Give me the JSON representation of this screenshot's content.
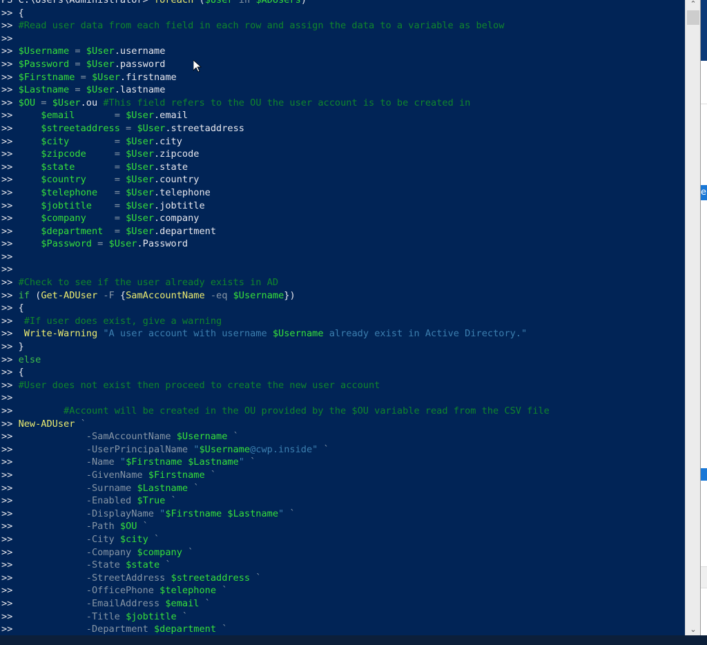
{
  "colors": {
    "background": "#012456",
    "variable": "#36e03a",
    "comment": "#10862c",
    "command": "#ecec70",
    "parameter": "#8796a6",
    "string": "#3c7fb0"
  },
  "lines": [
    [
      [
        "PS C:\\Users\\Administrator> ",
        "p"
      ],
      [
        "foreach",
        "cmd"
      ],
      [
        " (",
        "p"
      ],
      [
        "$User",
        "v"
      ],
      [
        " in ",
        "op"
      ],
      [
        "$ADUsers",
        "v"
      ],
      [
        ")",
        "p"
      ]
    ],
    [
      [
        ">> {",
        "p"
      ]
    ],
    [
      [
        ">> ",
        "p"
      ],
      [
        "#Read user data from each field in each row and assign the data to a variable as below",
        "c"
      ]
    ],
    [
      [
        ">>",
        "p"
      ]
    ],
    [
      [
        ">> ",
        "p"
      ],
      [
        "$Username",
        "v"
      ],
      [
        " = ",
        "op"
      ],
      [
        "$User",
        "v"
      ],
      [
        ".username",
        "p"
      ]
    ],
    [
      [
        ">> ",
        "p"
      ],
      [
        "$Password",
        "v"
      ],
      [
        " = ",
        "op"
      ],
      [
        "$User",
        "v"
      ],
      [
        ".password",
        "p"
      ]
    ],
    [
      [
        ">> ",
        "p"
      ],
      [
        "$Firstname",
        "v"
      ],
      [
        " = ",
        "op"
      ],
      [
        "$User",
        "v"
      ],
      [
        ".firstname",
        "p"
      ]
    ],
    [
      [
        ">> ",
        "p"
      ],
      [
        "$Lastname",
        "v"
      ],
      [
        " = ",
        "op"
      ],
      [
        "$User",
        "v"
      ],
      [
        ".lastname",
        "p"
      ]
    ],
    [
      [
        ">> ",
        "p"
      ],
      [
        "$OU",
        "v"
      ],
      [
        " = ",
        "op"
      ],
      [
        "$User",
        "v"
      ],
      [
        ".ou ",
        "p"
      ],
      [
        "#This field refers to the OU the user account is to be created in",
        "c"
      ]
    ],
    [
      [
        ">>     ",
        "p"
      ],
      [
        "$email",
        "v"
      ],
      [
        "       = ",
        "op"
      ],
      [
        "$User",
        "v"
      ],
      [
        ".email",
        "p"
      ]
    ],
    [
      [
        ">>     ",
        "p"
      ],
      [
        "$streetaddress",
        "v"
      ],
      [
        " = ",
        "op"
      ],
      [
        "$User",
        "v"
      ],
      [
        ".streetaddress",
        "p"
      ]
    ],
    [
      [
        ">>     ",
        "p"
      ],
      [
        "$city",
        "v"
      ],
      [
        "        = ",
        "op"
      ],
      [
        "$User",
        "v"
      ],
      [
        ".city",
        "p"
      ]
    ],
    [
      [
        ">>     ",
        "p"
      ],
      [
        "$zipcode",
        "v"
      ],
      [
        "     = ",
        "op"
      ],
      [
        "$User",
        "v"
      ],
      [
        ".zipcode",
        "p"
      ]
    ],
    [
      [
        ">>     ",
        "p"
      ],
      [
        "$state",
        "v"
      ],
      [
        "       = ",
        "op"
      ],
      [
        "$User",
        "v"
      ],
      [
        ".state",
        "p"
      ]
    ],
    [
      [
        ">>     ",
        "p"
      ],
      [
        "$country",
        "v"
      ],
      [
        "     = ",
        "op"
      ],
      [
        "$User",
        "v"
      ],
      [
        ".country",
        "p"
      ]
    ],
    [
      [
        ">>     ",
        "p"
      ],
      [
        "$telephone",
        "v"
      ],
      [
        "   = ",
        "op"
      ],
      [
        "$User",
        "v"
      ],
      [
        ".telephone",
        "p"
      ]
    ],
    [
      [
        ">>     ",
        "p"
      ],
      [
        "$jobtitle",
        "v"
      ],
      [
        "    = ",
        "op"
      ],
      [
        "$User",
        "v"
      ],
      [
        ".jobtitle",
        "p"
      ]
    ],
    [
      [
        ">>     ",
        "p"
      ],
      [
        "$company",
        "v"
      ],
      [
        "     = ",
        "op"
      ],
      [
        "$User",
        "v"
      ],
      [
        ".company",
        "p"
      ]
    ],
    [
      [
        ">>     ",
        "p"
      ],
      [
        "$department",
        "v"
      ],
      [
        "  = ",
        "op"
      ],
      [
        "$User",
        "v"
      ],
      [
        ".department",
        "p"
      ]
    ],
    [
      [
        ">>     ",
        "p"
      ],
      [
        "$Password",
        "v"
      ],
      [
        " = ",
        "op"
      ],
      [
        "$User",
        "v"
      ],
      [
        ".Password",
        "p"
      ]
    ],
    [
      [
        ">>",
        "p"
      ]
    ],
    [
      [
        ">>",
        "p"
      ]
    ],
    [
      [
        ">> ",
        "p"
      ],
      [
        "#Check to see if the user already exists in AD",
        "c"
      ]
    ],
    [
      [
        ">> ",
        "p"
      ],
      [
        "if",
        "kw"
      ],
      [
        " (",
        "p"
      ],
      [
        "Get-ADUser",
        "cmd"
      ],
      [
        " -F ",
        "op"
      ],
      [
        "{",
        "p"
      ],
      [
        "SamAccountName",
        "cmd"
      ],
      [
        " -eq ",
        "op"
      ],
      [
        "$Username",
        "v"
      ],
      [
        "})",
        "p"
      ]
    ],
    [
      [
        ">> {",
        "p"
      ]
    ],
    [
      [
        ">>  ",
        "p"
      ],
      [
        "#If user does exist, give a warning",
        "c"
      ]
    ],
    [
      [
        ">>  ",
        "p"
      ],
      [
        "Write-Warning",
        "cmd"
      ],
      [
        " \"A user account with username ",
        "s"
      ],
      [
        "$Username",
        "v"
      ],
      [
        " already exist in Active Directory.\"",
        "s"
      ]
    ],
    [
      [
        ">> }",
        "p"
      ]
    ],
    [
      [
        ">> ",
        "p"
      ],
      [
        "else",
        "kw"
      ]
    ],
    [
      [
        ">> {",
        "p"
      ]
    ],
    [
      [
        ">> ",
        "p"
      ],
      [
        "#User does not exist then proceed to create the new user account",
        "c"
      ]
    ],
    [
      [
        ">>",
        "p"
      ]
    ],
    [
      [
        ">>         ",
        "p"
      ],
      [
        "#Account will be created in the OU provided by the $OU variable read from the CSV file",
        "c"
      ]
    ],
    [
      [
        ">> ",
        "p"
      ],
      [
        "New-ADUser",
        "cmd"
      ],
      [
        " `",
        "op"
      ]
    ],
    [
      [
        ">>             ",
        "p"
      ],
      [
        "-SamAccountName ",
        "op"
      ],
      [
        "$Username",
        "v"
      ],
      [
        " `",
        "op"
      ]
    ],
    [
      [
        ">>             ",
        "p"
      ],
      [
        "-UserPrincipalName ",
        "op"
      ],
      [
        "\"",
        "s"
      ],
      [
        "$Username",
        "v"
      ],
      [
        "@cwp.inside\"",
        "s"
      ],
      [
        " `",
        "op"
      ]
    ],
    [
      [
        ">>             ",
        "p"
      ],
      [
        "-Name ",
        "op"
      ],
      [
        "\"",
        "s"
      ],
      [
        "$Firstname $Lastname",
        "v"
      ],
      [
        "\"",
        "s"
      ],
      [
        " `",
        "op"
      ]
    ],
    [
      [
        ">>             ",
        "p"
      ],
      [
        "-GivenName ",
        "op"
      ],
      [
        "$Firstname",
        "v"
      ],
      [
        " `",
        "op"
      ]
    ],
    [
      [
        ">>             ",
        "p"
      ],
      [
        "-Surname ",
        "op"
      ],
      [
        "$Lastname",
        "v"
      ],
      [
        " `",
        "op"
      ]
    ],
    [
      [
        ">>             ",
        "p"
      ],
      [
        "-Enabled ",
        "op"
      ],
      [
        "$True",
        "v"
      ],
      [
        " `",
        "op"
      ]
    ],
    [
      [
        ">>             ",
        "p"
      ],
      [
        "-DisplayName ",
        "op"
      ],
      [
        "\"",
        "s"
      ],
      [
        "$Firstname $Lastname",
        "v"
      ],
      [
        "\"",
        "s"
      ],
      [
        " `",
        "op"
      ]
    ],
    [
      [
        ">>             ",
        "p"
      ],
      [
        "-Path ",
        "op"
      ],
      [
        "$OU",
        "v"
      ],
      [
        " `",
        "op"
      ]
    ],
    [
      [
        ">>             ",
        "p"
      ],
      [
        "-City ",
        "op"
      ],
      [
        "$city",
        "v"
      ],
      [
        " `",
        "op"
      ]
    ],
    [
      [
        ">>             ",
        "p"
      ],
      [
        "-Company ",
        "op"
      ],
      [
        "$company",
        "v"
      ],
      [
        " `",
        "op"
      ]
    ],
    [
      [
        ">>             ",
        "p"
      ],
      [
        "-State ",
        "op"
      ],
      [
        "$state",
        "v"
      ],
      [
        " `",
        "op"
      ]
    ],
    [
      [
        ">>             ",
        "p"
      ],
      [
        "-StreetAddress ",
        "op"
      ],
      [
        "$streetaddress",
        "v"
      ],
      [
        " `",
        "op"
      ]
    ],
    [
      [
        ">>             ",
        "p"
      ],
      [
        "-OfficePhone ",
        "op"
      ],
      [
        "$telephone",
        "v"
      ],
      [
        " `",
        "op"
      ]
    ],
    [
      [
        ">>             ",
        "p"
      ],
      [
        "-EmailAddress ",
        "op"
      ],
      [
        "$email",
        "v"
      ],
      [
        " `",
        "op"
      ]
    ],
    [
      [
        ">>             ",
        "p"
      ],
      [
        "-Title ",
        "op"
      ],
      [
        "$jobtitle",
        "v"
      ],
      [
        " `",
        "op"
      ]
    ],
    [
      [
        ">>             ",
        "p"
      ],
      [
        "-Department ",
        "op"
      ],
      [
        "$department",
        "v"
      ],
      [
        " `",
        "op"
      ]
    ]
  ],
  "scrollbar": {
    "up_icon": "▲",
    "down_icon": "▼"
  },
  "background_window": {
    "visible_letter": "e"
  }
}
